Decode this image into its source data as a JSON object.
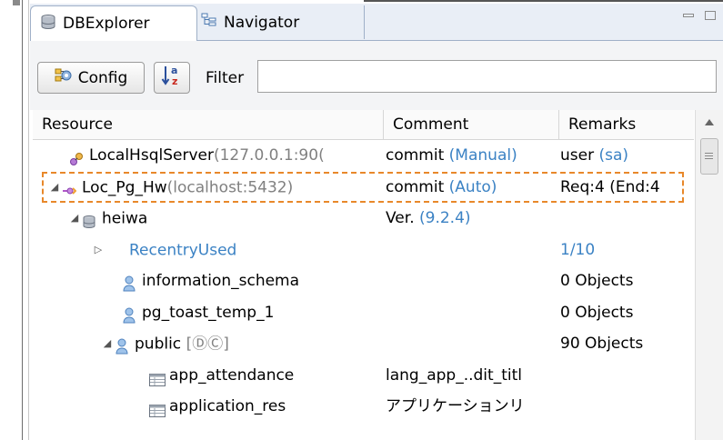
{
  "tabs": [
    {
      "label": "DBExplorer",
      "icon": "database-icon",
      "active": true
    },
    {
      "label": "Navigator",
      "icon": "navigator-icon",
      "active": false
    }
  ],
  "toolbar": {
    "config_label": "Config",
    "sort_icon": "sort-az-icon",
    "filter_label": "Filter",
    "filter_value": ""
  },
  "columns": {
    "resource": "Resource",
    "comment": "Comment",
    "remarks": "Remarks"
  },
  "rows": [
    {
      "resource_main": "LocalHsqlServer",
      "resource_extra": "(127.0.0.1:90(",
      "comment_main": "commit ",
      "comment_extra": "(Manual)",
      "remarks_main": "user ",
      "remarks_extra": "(sa)",
      "icon": "server-icon"
    },
    {
      "resource_main": "Loc_Pg_Hw",
      "resource_extra": "(localhost:5432)",
      "comment_main": "commit ",
      "comment_extra": "(Auto)",
      "remarks_main": "Req:4 (End:4",
      "remarks_extra": "",
      "icon": "server-icon",
      "selected": true
    },
    {
      "resource_main": "heiwa",
      "resource_extra": "",
      "comment_main": "Ver. ",
      "comment_extra": "(9.2.4)",
      "remarks_main": "",
      "remarks_extra": "",
      "icon": "database-icon"
    },
    {
      "resource_main": "RecentryUsed",
      "resource_extra": "",
      "comment_main": "",
      "comment_extra": "",
      "remarks_main": "1/10",
      "remarks_extra": "",
      "icon": ""
    },
    {
      "resource_main": "information_schema",
      "resource_extra": "",
      "comment_main": "",
      "comment_extra": "",
      "remarks_main": "0 Objects",
      "remarks_extra": "",
      "icon": "schema-icon"
    },
    {
      "resource_main": "pg_toast_temp_1",
      "resource_extra": "",
      "comment_main": "",
      "comment_extra": "",
      "remarks_main": "0 Objects",
      "remarks_extra": "",
      "icon": "schema-icon"
    },
    {
      "resource_main": "public ",
      "resource_extra": "[ⒹⒸ]",
      "comment_main": "",
      "comment_extra": "",
      "remarks_main": "90 Objects",
      "remarks_extra": "",
      "icon": "schema-icon"
    },
    {
      "resource_main": "app_attendance",
      "resource_extra": "",
      "comment_main": "lang_app_..dit_titl",
      "comment_extra": "",
      "remarks_main": "",
      "remarks_extra": "",
      "icon": "table-icon"
    },
    {
      "resource_main": "application_res",
      "resource_extra": "",
      "comment_main": "アプリケーションリ",
      "comment_extra": "",
      "remarks_main": "",
      "remarks_extra": "",
      "icon": "table-icon"
    }
  ]
}
